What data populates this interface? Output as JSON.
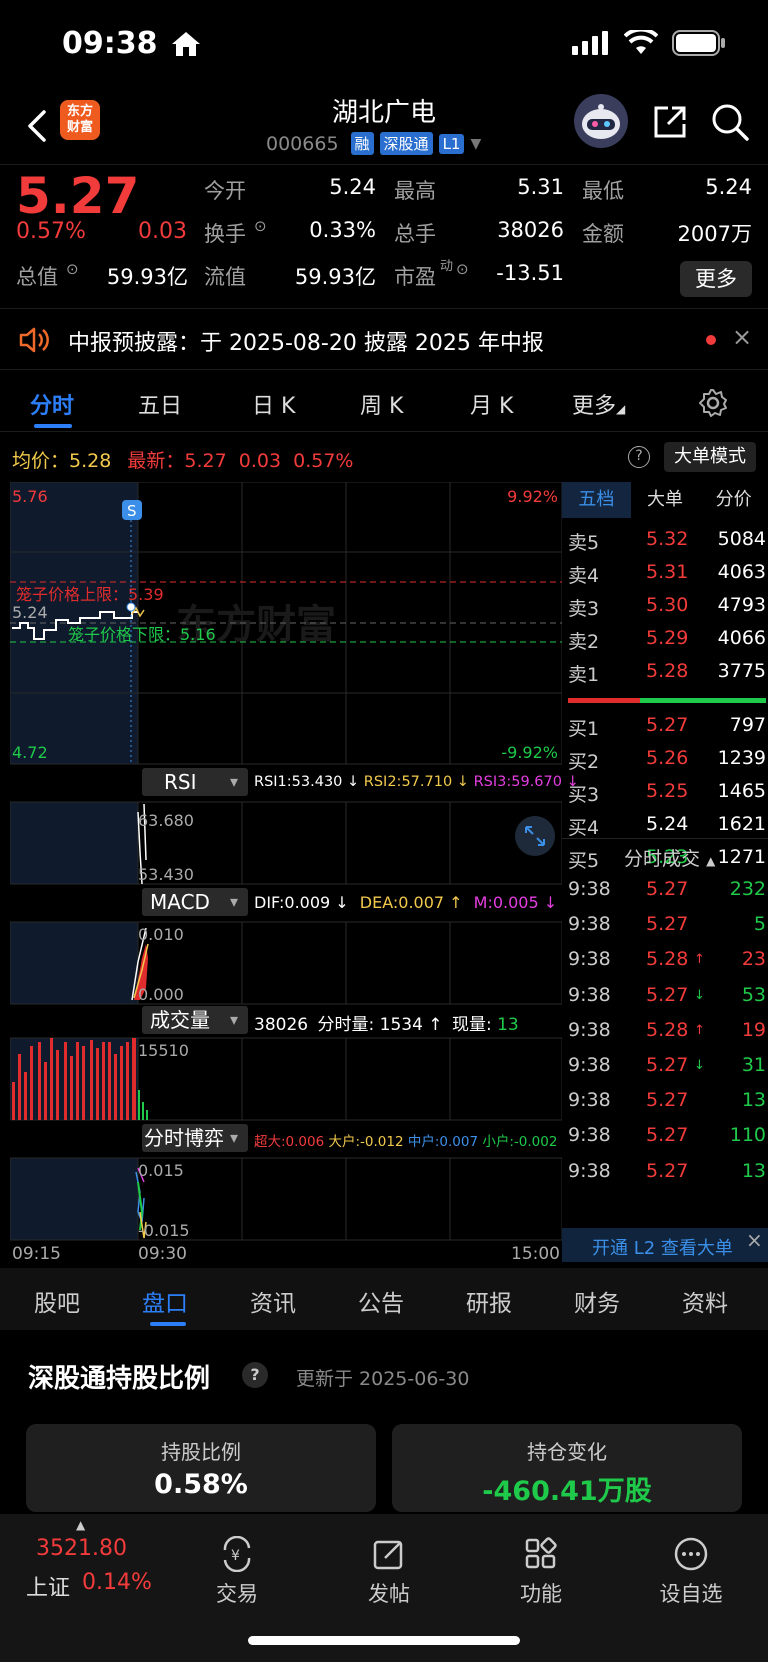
{
  "status": {
    "time": "09:38"
  },
  "header": {
    "logo_line1": "东方",
    "logo_line2": "财富",
    "name": "湖北广电",
    "code": "000665",
    "tags": [
      "融",
      "深股通",
      "L1"
    ]
  },
  "quote": {
    "price": "5.27",
    "change_pct": "0.57%",
    "change": "0.03",
    "fields": [
      {
        "label": "今开",
        "value": "5.24",
        "color": "white"
      },
      {
        "label": "最高",
        "value": "5.31",
        "color": "red"
      },
      {
        "label": "最低",
        "value": "5.24",
        "color": "white"
      },
      {
        "label": "换手",
        "value": "0.33%",
        "color": "white"
      },
      {
        "label": "总手",
        "value": "38026",
        "color": "white"
      },
      {
        "label": "金额",
        "value": "2007万",
        "color": "white"
      },
      {
        "label": "总值",
        "value": "59.93亿",
        "color": "white"
      },
      {
        "label": "流值",
        "value": "59.93亿",
        "color": "white"
      },
      {
        "label": "市盈",
        "value": "-13.51",
        "color": "white"
      }
    ],
    "pe_superscript": "动",
    "more": "更多"
  },
  "notice": {
    "text": "中报预披露：于 2025-08-20 披露 2025 年中报"
  },
  "chart_tabs": [
    "分时",
    "五日",
    "日 K",
    "周 K",
    "月 K",
    "更多"
  ],
  "info_line": {
    "avg_label": "均价：",
    "avg_value": "5.28",
    "latest_label": "最新：",
    "latest_value": "5.27",
    "change": "0.03",
    "change_pct": "0.57%",
    "help": "?",
    "big_mode": "大单模式"
  },
  "chart": {
    "price_high": "5.76",
    "price_low": "4.72",
    "price_open": "5.24",
    "pct_high": "9.92%",
    "pct_low": "-9.92%",
    "cage_upper": "笼子价格上限：5.39",
    "cage_lower": "笼子价格下限：5.16",
    "s_marker": "S",
    "watermark": "东方财富",
    "time_start": "09:15",
    "time_mid": "09:30",
    "time_end": "15:00"
  },
  "rsi": {
    "label": "RSI",
    "rsi1": "RSI1:53.430 ↓",
    "rsi2": "RSI2:57.710 ↓",
    "rsi3": "RSI3:59.670 ↓",
    "top": "63.680",
    "bottom": "53.430"
  },
  "macd": {
    "label": "MACD",
    "dif": "DIF:0.009 ↓",
    "dea": "DEA:0.007 ↑",
    "m": "M:0.005 ↓",
    "top": "0.010",
    "bottom": "0.000"
  },
  "volume": {
    "label": "成交量",
    "total": "38026",
    "fenshi_label": "分时量: 1534 ↑",
    "xian_label": "现量:",
    "xian_value": "13",
    "top": "15510"
  },
  "game": {
    "label": "分时博弈",
    "chaoda": "超大:0.006",
    "dahu": "大户:-0.012",
    "zhonghu": "中户:0.007",
    "xiaohu": "小户:-0.002",
    "top": "0.015",
    "bottom": "-0.015"
  },
  "book": {
    "tabs": [
      "五档",
      "大单",
      "分价"
    ],
    "asks": [
      {
        "label": "卖5",
        "price": "5.32",
        "vol": "5084",
        "color": "red"
      },
      {
        "label": "卖4",
        "price": "5.31",
        "vol": "4063",
        "color": "red"
      },
      {
        "label": "卖3",
        "price": "5.30",
        "vol": "4793",
        "color": "red"
      },
      {
        "label": "卖2",
        "price": "5.29",
        "vol": "4066",
        "color": "red"
      },
      {
        "label": "卖1",
        "price": "5.28",
        "vol": "3775",
        "color": "red"
      }
    ],
    "bids": [
      {
        "label": "买1",
        "price": "5.27",
        "vol": "797",
        "color": "red"
      },
      {
        "label": "买2",
        "price": "5.26",
        "vol": "1239",
        "color": "red"
      },
      {
        "label": "买3",
        "price": "5.25",
        "vol": "1465",
        "color": "red"
      },
      {
        "label": "买4",
        "price": "5.24",
        "vol": "1621",
        "color": "white"
      },
      {
        "label": "买5",
        "price": "5.23",
        "vol": "1271",
        "color": "green"
      }
    ],
    "trades_title": "分时成交",
    "trades": [
      {
        "time": "9:38",
        "price": "5.27",
        "arrow": "",
        "vol": "232",
        "vcolor": "green"
      },
      {
        "time": "9:38",
        "price": "5.27",
        "arrow": "",
        "vol": "5",
        "vcolor": "green"
      },
      {
        "time": "9:38",
        "price": "5.28",
        "arrow": "↑",
        "vol": "23",
        "vcolor": "red"
      },
      {
        "time": "9:38",
        "price": "5.27",
        "arrow": "↓",
        "vol": "53",
        "vcolor": "green"
      },
      {
        "time": "9:38",
        "price": "5.28",
        "arrow": "↑",
        "vol": "19",
        "vcolor": "red"
      },
      {
        "time": "9:38",
        "price": "5.27",
        "arrow": "↓",
        "vol": "31",
        "vcolor": "green"
      },
      {
        "time": "9:38",
        "price": "5.27",
        "arrow": "",
        "vol": "13",
        "vcolor": "green"
      },
      {
        "time": "9:38",
        "price": "5.27",
        "arrow": "",
        "vol": "110",
        "vcolor": "green"
      },
      {
        "time": "9:38",
        "price": "5.27",
        "arrow": "",
        "vol": "13",
        "vcolor": "green"
      }
    ],
    "l2_banner": "开通 L2 查看大单"
  },
  "info_tabs": [
    "股吧",
    "盘口",
    "资讯",
    "公告",
    "研报",
    "财务",
    "资料"
  ],
  "holding": {
    "title": "深股通持股比例",
    "updated": "更新于 2025-06-30",
    "ratio_label": "持股比例",
    "ratio_value": "0.58%",
    "change_label": "持仓变化",
    "change_value": "-460.41万股"
  },
  "nav": {
    "index_value": "3521.80",
    "index_name": "上证",
    "index_pct": "0.14%",
    "items": [
      "交易",
      "发帖",
      "功能",
      "设自选"
    ]
  }
}
